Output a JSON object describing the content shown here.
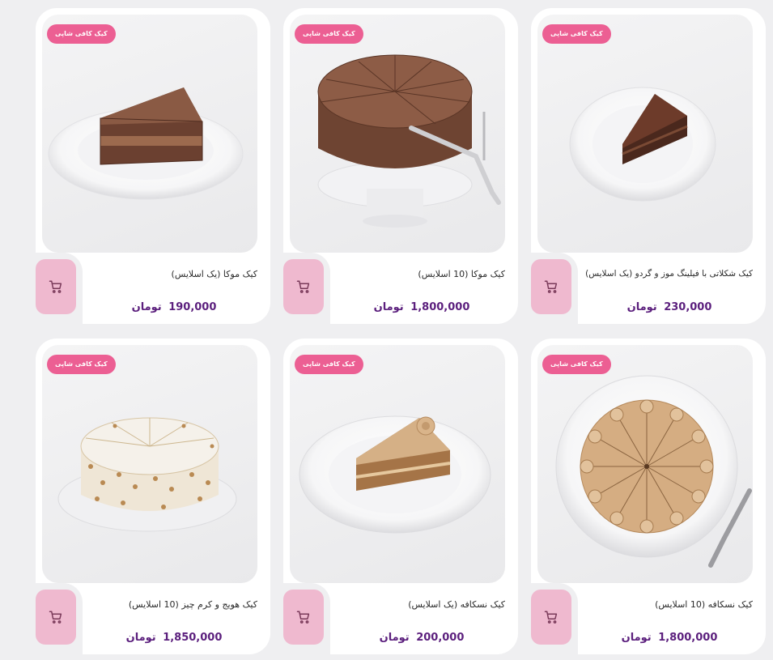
{
  "products": [
    {
      "badge": "کیک کافی شاپی",
      "title": "کیک موکا (یک اسلایس)",
      "price": "190,000",
      "currency": "تومان",
      "image": "mocha-slice"
    },
    {
      "badge": "کیک کافی شاپی",
      "title": "کیک موکا (10 اسلایس)",
      "price": "1,800,000",
      "currency": "تومان",
      "image": "mocha-whole"
    },
    {
      "badge": "کیک کافی شاپی",
      "title": "کیک شکلاتی با فیلینگ موز و گردو (یک اسلایس)",
      "price": "230,000",
      "currency": "تومان",
      "image": "chocolate-slice"
    },
    {
      "badge": "کیک کافی شاپی",
      "title": "کیک هویج و کرم چیز (10 اسلایس)",
      "price": "1,850,000",
      "currency": "تومان",
      "image": "carrot-whole"
    },
    {
      "badge": "کیک کافی شاپی",
      "title": "کیک نسکافه (یک اسلایس)",
      "price": "200,000",
      "currency": "تومان",
      "image": "nescafe-slice"
    },
    {
      "badge": "کیک کافی شاپی",
      "title": "کیک نسکافه (10 اسلایس)",
      "price": "1,800,000",
      "currency": "تومان",
      "image": "nescafe-whole"
    }
  ],
  "icons": {
    "cart": "shopping-cart-icon"
  },
  "colors": {
    "badge": "#ec5f93",
    "cart_bg": "#efb9cf",
    "price": "#5b1f7d",
    "page_bg": "#efeff1"
  }
}
